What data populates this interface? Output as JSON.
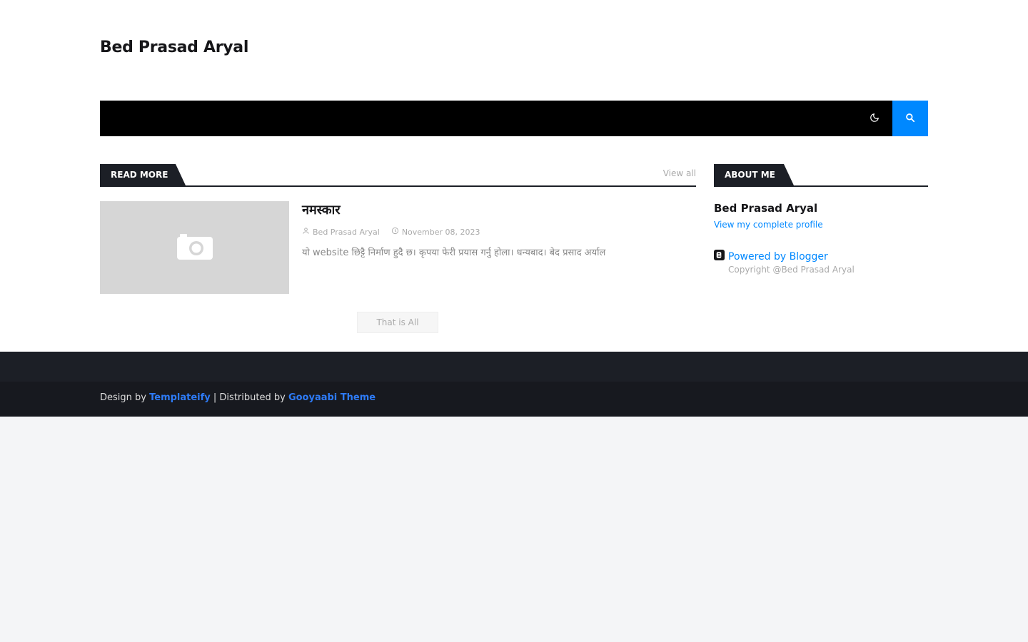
{
  "header": {
    "site_title": "Bed Prasad Aryal"
  },
  "nav": {
    "dark_mode_icon": "moon-icon",
    "search_icon": "search-icon",
    "accent": "#0088ff"
  },
  "main": {
    "section_title": "Read More",
    "view_all": "View all",
    "post": {
      "title": "नमस्कार",
      "author": "Bed Prasad Aryal",
      "date": "November 08, 2023",
      "snippet": "यो website छिट्टै निर्माण हुदै छ। कृपया फेरी प्रयास गर्नु होला।   धन्यबाद।  बेद प्रसाद अर्याल"
    },
    "end_label": "That is All"
  },
  "sidebar": {
    "section_title": "About Me",
    "profile_name": "Bed Prasad Aryal",
    "profile_link": "View my complete profile",
    "powered_by": "Powered by Blogger",
    "copyright": "Copyright @Bed Prasad Aryal"
  },
  "footer": {
    "design_by_prefix": "Design by",
    "design_by_link": "Templateify",
    "distributed_prefix": "| Distributed by",
    "distributed_link": "Gooyaabi Theme"
  }
}
